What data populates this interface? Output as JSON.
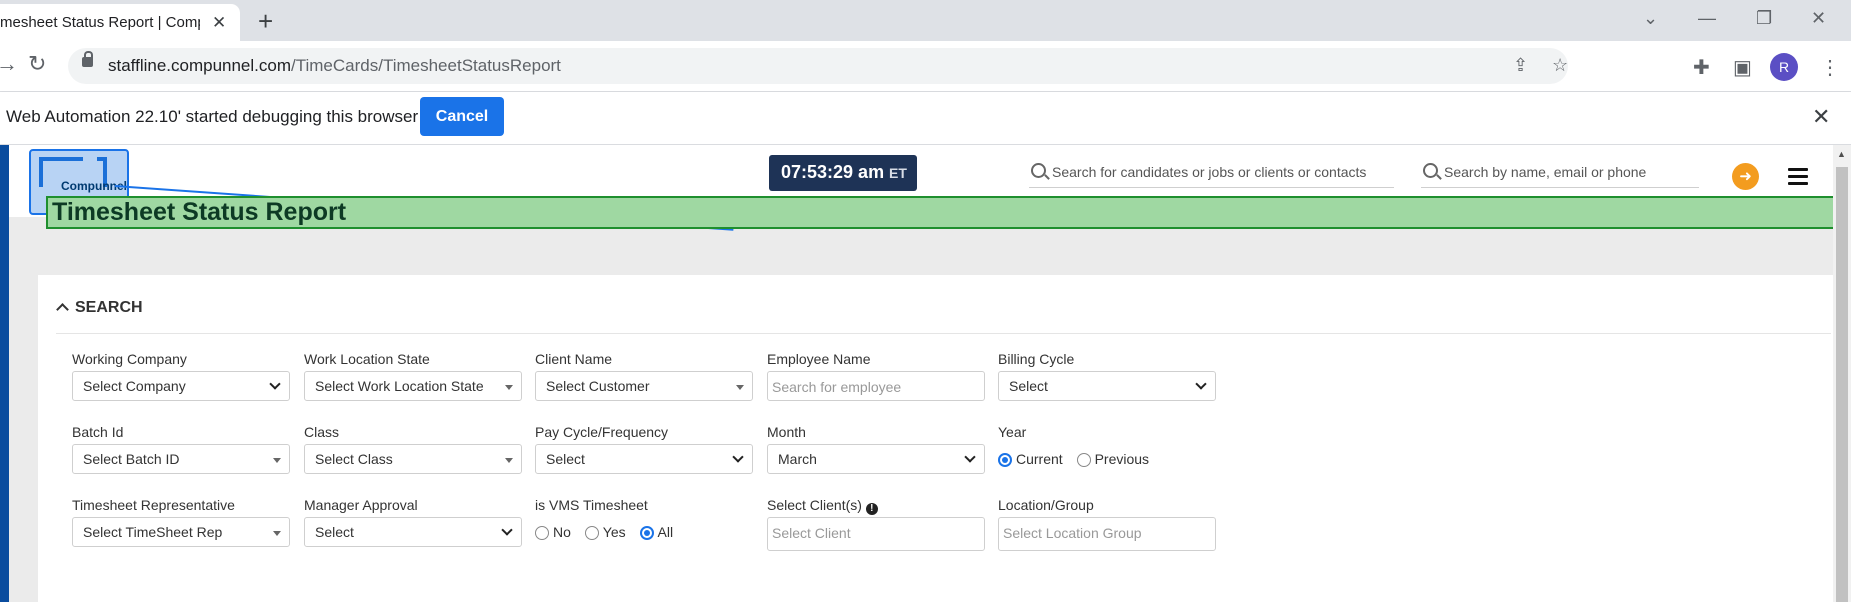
{
  "browser": {
    "tab_title": "mesheet Status Report | Compu",
    "url_host": "staffline.compunnel.com",
    "url_path": "/TimeCards/TimesheetStatusReport",
    "profile_initial": "R"
  },
  "infobar": {
    "message": "Web Automation 22.10' started debugging this browser",
    "cancel_label": "Cancel"
  },
  "header": {
    "logo_text": "Compunnel",
    "clock_time": "07:53:29 am",
    "clock_tz": "ET",
    "global_search_placeholder": "Search for candidates or jobs or clients or contacts",
    "people_search_placeholder": "Search by name, email or phone"
  },
  "page_title": "Timesheet Status Report",
  "search": {
    "heading": "SEARCH",
    "fields": {
      "working_company": {
        "label": "Working Company",
        "value": "Select Company"
      },
      "work_location_state": {
        "label": "Work Location State",
        "value": "Select Work Location State"
      },
      "client_name": {
        "label": "Client Name",
        "value": "Select Customer"
      },
      "employee_name": {
        "label": "Employee Name",
        "placeholder": "Search for employee"
      },
      "billing_cycle": {
        "label": "Billing Cycle",
        "value": "Select"
      },
      "batch_id": {
        "label": "Batch Id",
        "value": "Select Batch ID"
      },
      "class": {
        "label": "Class",
        "value": "Select Class"
      },
      "pay_cycle": {
        "label": "Pay Cycle/Frequency",
        "value": "Select"
      },
      "month": {
        "label": "Month",
        "value": "March"
      },
      "year": {
        "label": "Year",
        "options": [
          "Current",
          "Previous"
        ],
        "selected": "Current"
      },
      "timesheet_rep": {
        "label": "Timesheet Representative",
        "value": "Select TimeSheet Rep"
      },
      "manager_approval": {
        "label": "Manager Approval",
        "value": "Select"
      },
      "is_vms": {
        "label": "is VMS Timesheet",
        "options": [
          "No",
          "Yes",
          "All"
        ],
        "selected": "All"
      },
      "select_clients": {
        "label": "Select Client(s)",
        "placeholder": "Select Client"
      },
      "location_group": {
        "label": "Location/Group",
        "placeholder": "Select Location Group"
      }
    }
  }
}
